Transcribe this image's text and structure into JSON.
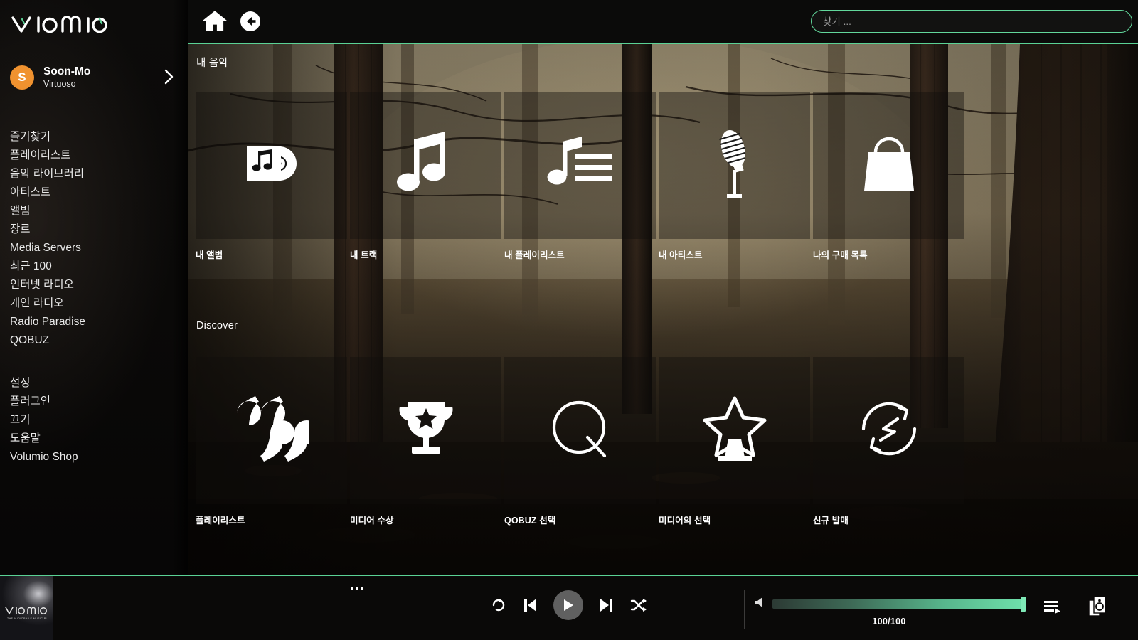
{
  "app": {
    "brand": "VOLUMIO",
    "accent": "#5ad295",
    "avatar_color": "#f0922f"
  },
  "sidebar": {
    "user": {
      "initial": "S",
      "name": "Soon-Mo",
      "role": "Virtuoso",
      "chevron_icon": "chevron-right-icon"
    },
    "primary_items": [
      {
        "label": "즐겨찾기"
      },
      {
        "label": "플레이리스트"
      },
      {
        "label": "음악 라이브러리"
      },
      {
        "label": "아티스트"
      },
      {
        "label": "앨범"
      },
      {
        "label": "장르"
      },
      {
        "label": "Media Servers"
      },
      {
        "label": "최근 100"
      },
      {
        "label": "인터넷 라디오"
      },
      {
        "label": "개인 라디오"
      },
      {
        "label": "Radio Paradise"
      },
      {
        "label": "QOBUZ"
      }
    ],
    "secondary_items": [
      {
        "label": "설정"
      },
      {
        "label": "플러그인"
      },
      {
        "label": "끄기"
      },
      {
        "label": "도움말"
      },
      {
        "label": "Volumio Shop"
      }
    ]
  },
  "topbar": {
    "home_icon": "home-icon",
    "back_icon": "back-circle-icon",
    "search": {
      "value": "",
      "placeholder": "찾기 ..."
    }
  },
  "main": {
    "sections": [
      {
        "title": "내 음악",
        "tiles": [
          {
            "label": "내 앨범",
            "icon": "album-disc-icon"
          },
          {
            "label": "내 트랙",
            "icon": "music-note-icon"
          },
          {
            "label": "내 플레이리스트",
            "icon": "playlist-note-icon"
          },
          {
            "label": "내 아티스트",
            "icon": "microphone-icon"
          },
          {
            "label": "나의 구매 목록",
            "icon": "shopping-bag-icon"
          }
        ]
      },
      {
        "title": "Discover",
        "tiles": [
          {
            "label": "플레이리스트",
            "icon": "quote-marks-icon"
          },
          {
            "label": "미디어 수상",
            "icon": "trophy-icon"
          },
          {
            "label": "QOBUZ 선택",
            "icon": "qobuz-q-icon"
          },
          {
            "label": "미디어의 선택",
            "icon": "star-award-icon"
          },
          {
            "label": "신규 발매",
            "icon": "refresh-sync-icon"
          }
        ]
      }
    ]
  },
  "player": {
    "album_art_caption": "volumio",
    "album_art_sub": "THE AUDIOPHILE MUSIC PLAYER",
    "track_menu_icon": "more-dots-icon",
    "controls": {
      "repeat_icon": "repeat-icon",
      "previous_icon": "previous-icon",
      "play_icon": "play-icon",
      "next_icon": "next-icon",
      "shuffle_icon": "shuffle-icon"
    },
    "volume": {
      "mute_icon": "speaker-icon",
      "value": 100,
      "max": 100,
      "label": "100/100"
    },
    "queue_icon": "queue-list-icon",
    "output_icon": "audio-output-icon"
  }
}
